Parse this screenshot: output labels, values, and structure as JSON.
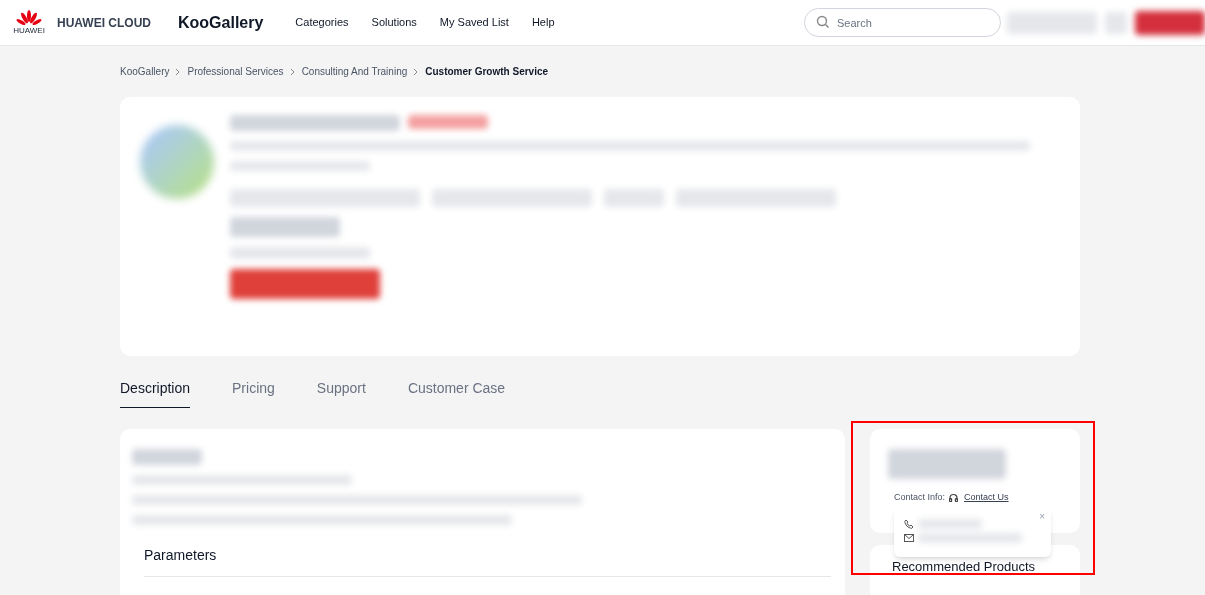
{
  "header": {
    "brand_mark": "HUAWEI",
    "brand": "HUAWEI CLOUD",
    "product": "KooGallery",
    "nav": [
      {
        "label": "Categories"
      },
      {
        "label": "Solutions"
      },
      {
        "label": "My Saved List"
      },
      {
        "label": "Help"
      }
    ],
    "search": {
      "placeholder": "Search"
    }
  },
  "breadcrumb": [
    {
      "label": "KooGallery",
      "current": false
    },
    {
      "label": "Professional Services",
      "current": false
    },
    {
      "label": "Consulting And Training",
      "current": false
    },
    {
      "label": "Customer Growth Service",
      "current": true
    }
  ],
  "tabs": [
    {
      "label": "Description",
      "selected": true
    },
    {
      "label": "Pricing",
      "selected": false
    },
    {
      "label": "Support",
      "selected": false
    },
    {
      "label": "Customer Case",
      "selected": false
    }
  ],
  "description": {
    "section_title": "Parameters"
  },
  "seller_card": {
    "contact_label": "Contact Info:",
    "contact_link": "Contact Us"
  },
  "contact_popup": {
    "close": "×"
  },
  "recommended": {
    "title": "Recommended Products"
  }
}
